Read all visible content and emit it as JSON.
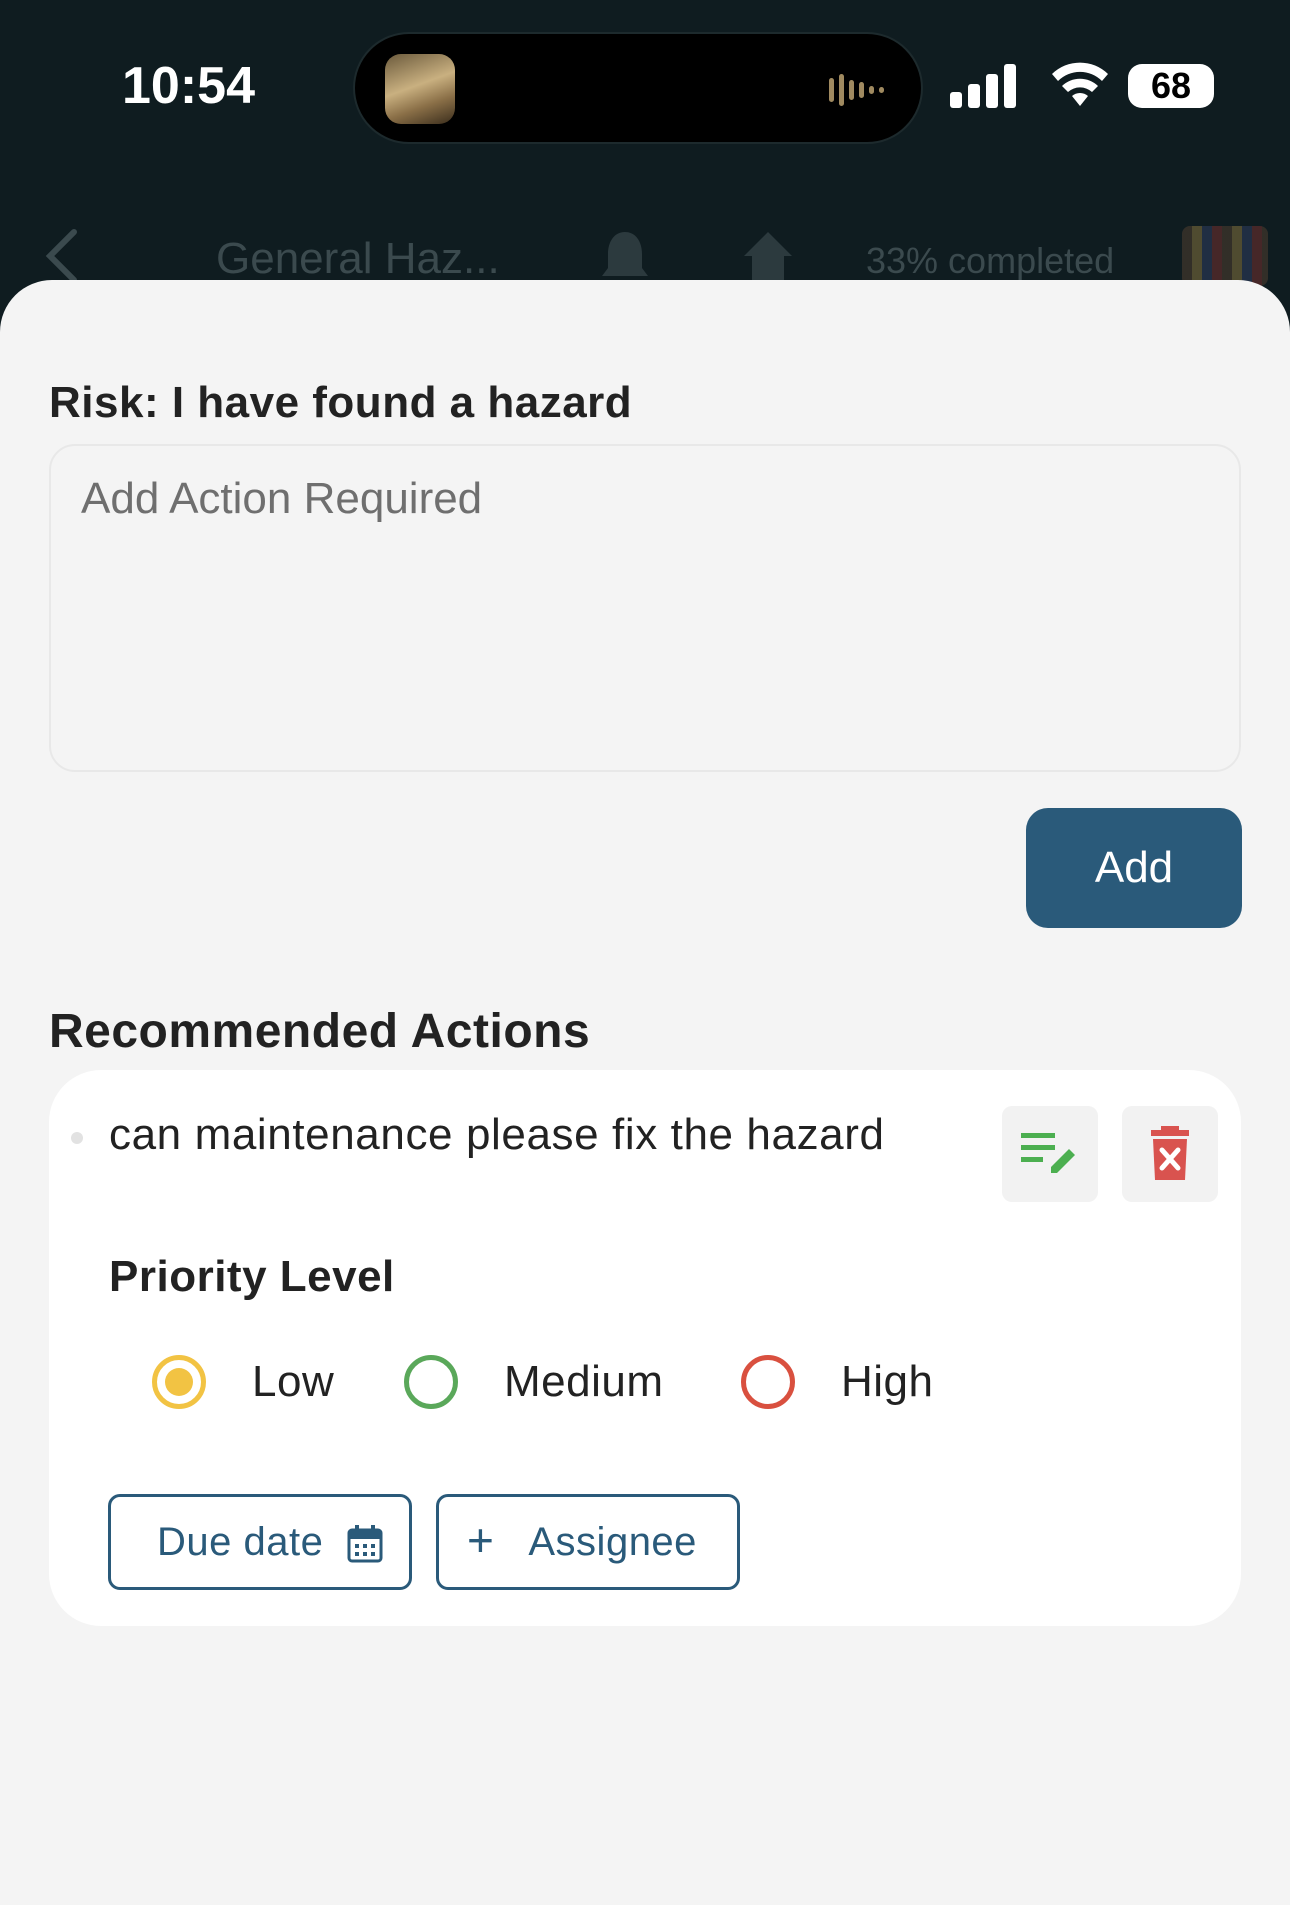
{
  "status_bar": {
    "time": "10:54",
    "battery": "68"
  },
  "nav": {
    "title": "General Haz...",
    "progress": "33% completed",
    "back_icon": "chevron-left-icon",
    "bell_icon": "bell-icon",
    "home_icon": "home-icon"
  },
  "risk": {
    "title": "Risk: I have found a hazard",
    "input_placeholder": "Add Action Required",
    "input_value": "",
    "add_label": "Add"
  },
  "recommended": {
    "title": "Recommended Actions",
    "items": [
      {
        "text": "can maintenance please fix the hazard",
        "priority_title": "Priority Level",
        "priority_options": [
          {
            "label": "Low",
            "color": "#f2c343",
            "selected": true
          },
          {
            "label": "Medium",
            "color": "#5aa85a",
            "selected": false
          },
          {
            "label": "High",
            "color": "#d9503f",
            "selected": false
          }
        ],
        "due_date_label": "Due date",
        "assignee_label": "Assignee",
        "assignee_prefix": "+"
      }
    ]
  },
  "colors": {
    "primary": "#2a5a7a",
    "edit_icon": "#4caf50",
    "delete_icon": "#d9534f",
    "sheet_bg": "#f4f4f4",
    "header_bg": "#0f1c20"
  }
}
